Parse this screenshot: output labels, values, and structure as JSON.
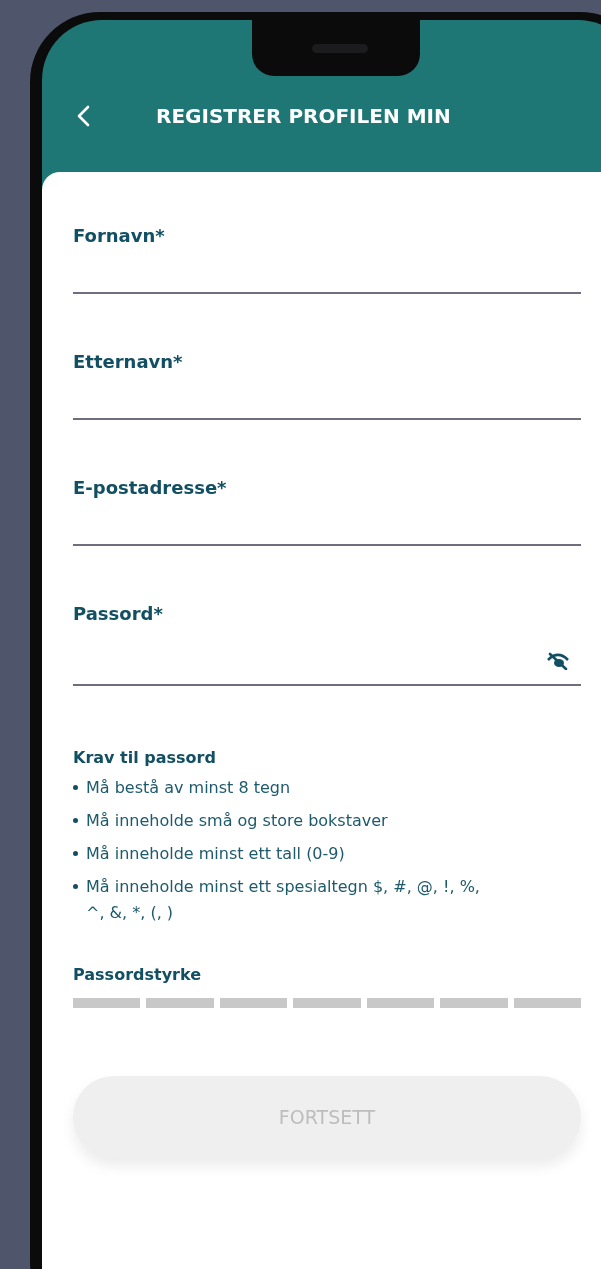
{
  "header": {
    "title": "REGISTRER PROFILEN MIN"
  },
  "fields": [
    {
      "kind": "text",
      "label": "Fornavn*"
    },
    {
      "kind": "text",
      "label": "Etternavn*"
    },
    {
      "kind": "email",
      "label": "E-postadresse*"
    },
    {
      "kind": "password",
      "label": "Passord*"
    }
  ],
  "requirements": {
    "title": "Krav til passord",
    "items": [
      "Må bestå av minst 8 tegn",
      "Må inneholde små og store bokstaver",
      "Må inneholde minst ett tall (0-9)",
      "Må inneholde minst ett spesialtegn $, #, @, !, %, ^, &, *, (, )"
    ]
  },
  "strength": {
    "label": "Passordstyrke"
  },
  "continue_button": {
    "label": "FORTSETT",
    "disabled": true
  }
}
